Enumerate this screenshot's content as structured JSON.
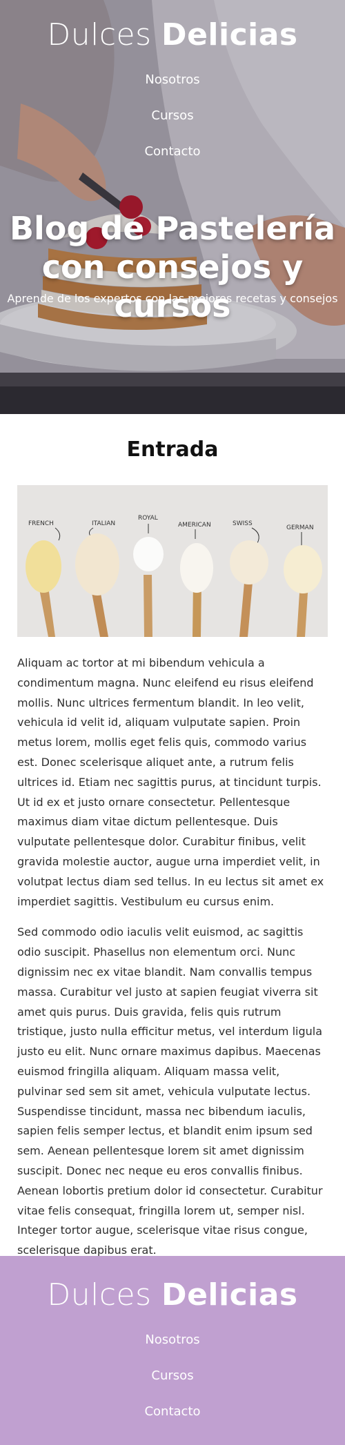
{
  "site": {
    "logo_light": "Dulces",
    "logo_bold": "Delicias"
  },
  "nav": [
    {
      "label": "Nosotros"
    },
    {
      "label": "Cursos"
    },
    {
      "label": "Contacto"
    }
  ],
  "hero": {
    "title": "Blog de Pastelería con consejos y cursos",
    "subtitle": "Aprende de los expertos con las mejores recetas y consejos"
  },
  "entry": {
    "title": "Entrada",
    "image_labels": [
      "FRENCH",
      "ITALIAN",
      "ROYAL",
      "AMERICAN",
      "SWISS",
      "GERMAN"
    ],
    "paragraphs": [
      "Aliquam ac tortor at mi bibendum vehicula a condimentum magna. Nunc eleifend eu risus eleifend mollis. Nunc ultrices fermentum blandit. In leo velit, vehicula id velit id, aliquam vulputate sapien. Proin metus lorem, mollis eget felis quis, commodo varius est. Donec scelerisque aliquet ante, a rutrum felis ultrices id. Etiam nec sagittis purus, at tincidunt turpis. Ut id ex et justo ornare consectetur. Pellentesque maximus diam vitae dictum pellentesque. Duis vulputate pellentesque dolor. Curabitur finibus, velit gravida molestie auctor, augue urna imperdiet velit, in volutpat lectus diam sed tellus. In eu lectus sit amet ex imperdiet sagittis. Vestibulum eu cursus enim.",
      "Sed commodo odio iaculis velit euismod, ac sagittis odio suscipit. Phasellus non elementum orci. Nunc dignissim nec ex vitae blandit. Nam convallis tempus massa. Curabitur vel justo at sapien feugiat viverra sit amet quis purus. Duis gravida, felis quis rutrum tristique, justo nulla efficitur metus, vel interdum ligula justo eu elit. Nunc ornare maximus dapibus. Maecenas euismod fringilla aliquam. Aliquam massa velit, pulvinar sed sem sit amet, vehicula vulputate lectus. Suspendisse tincidunt, massa nec bibendum iaculis, sapien felis semper lectus, et blandit enim ipsum sed sem. Aenean pellentesque lorem sit amet dignissim suscipit. Donec nec neque eu eros convallis finibus. Aenean lobortis pretium dolor id consectetur. Curabitur vitae felis consequat, fringilla lorem ut, semper nisl. Integer tortor augue, scelerisque vitae risus congue, scelerisque dapibus erat."
    ]
  },
  "colors": {
    "footer_bg": "#c0a0d0",
    "text": "#2e2e2e",
    "heading": "#111111"
  }
}
